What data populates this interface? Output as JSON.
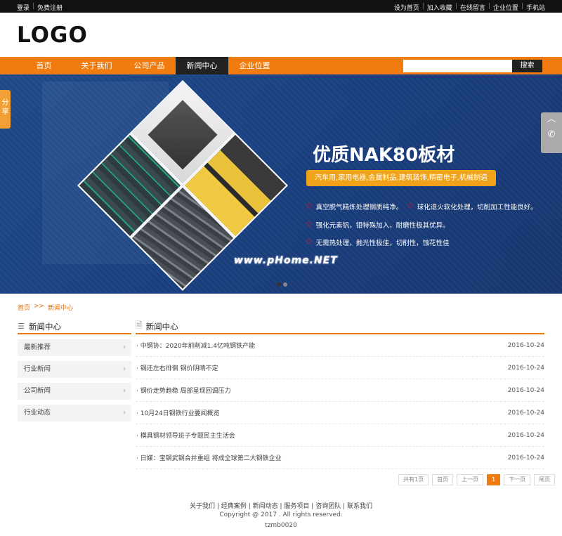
{
  "topbar": {
    "left": [
      "登录",
      "免费注册"
    ],
    "right": [
      "设为首页",
      "加入收藏",
      "在线留言",
      "企业位置",
      "手机站"
    ]
  },
  "logo": "LOGO",
  "nav": {
    "items": [
      "首页",
      "关于我们",
      "公司产品",
      "新闻中心",
      "企业位置"
    ],
    "active": "新闻中心",
    "search_placeholder": "",
    "search_button": "搜索"
  },
  "banner": {
    "title": "优质NAK80板材",
    "tag": "汽车用,家用电器,金属制品,建筑装饰,精密电子,机械制造",
    "features": [
      "真空脱气精炼处理钢质纯净。",
      "球化退火软化处理，切削加工性能良好。",
      "强化元素钒，钼特殊加入，耐磨性极其优异。",
      "无需热处理，抛光性极佳，切削性，蚀花性佳"
    ],
    "watermark": "www.pHome.NET"
  },
  "share_tab": "分享",
  "breadcrumb": {
    "home": "首页",
    "sep": ">>",
    "current": "新闻中心"
  },
  "sidebar": {
    "title": "新闻中心",
    "items": [
      "最新推荐",
      "行业新闻",
      "公司新闻",
      "行业动态"
    ]
  },
  "main": {
    "title": "新闻中心",
    "news": [
      {
        "title": "· 中钢协：2020年前削减1.4亿吨钢铁产能",
        "date": "2016-10-24"
      },
      {
        "title": "· 钢还左右徘徊 钢价阴晴不定",
        "date": "2016-10-24"
      },
      {
        "title": "· 钢价走势趋稳 局部呈现回调压力",
        "date": "2016-10-24"
      },
      {
        "title": "· 10月24日钢铁行业要闻概览",
        "date": "2016-10-24"
      },
      {
        "title": "· 模具钢材领导班子专题民主生活会",
        "date": "2016-10-24"
      },
      {
        "title": "· 日媒：宝钢武钢合并重组 将成全球第二大钢铁企业",
        "date": "2016-10-24"
      }
    ]
  },
  "pager": {
    "total": "共有1页",
    "first": "首页",
    "prev": "上一页",
    "current": "1",
    "next": "下一页",
    "last": "尾页"
  },
  "footer": {
    "links": [
      "关于我们",
      "经典案例",
      "新闻动态",
      "服务项目",
      "咨询团队",
      "联系我们"
    ],
    "copyright": "Copyright @ 2017 . All rights reserved.",
    "code": "tzmb0020"
  },
  "colors": {
    "accent": "#f07c0f",
    "banner_blue": "#1e4a8a",
    "topbar": "#111111"
  }
}
